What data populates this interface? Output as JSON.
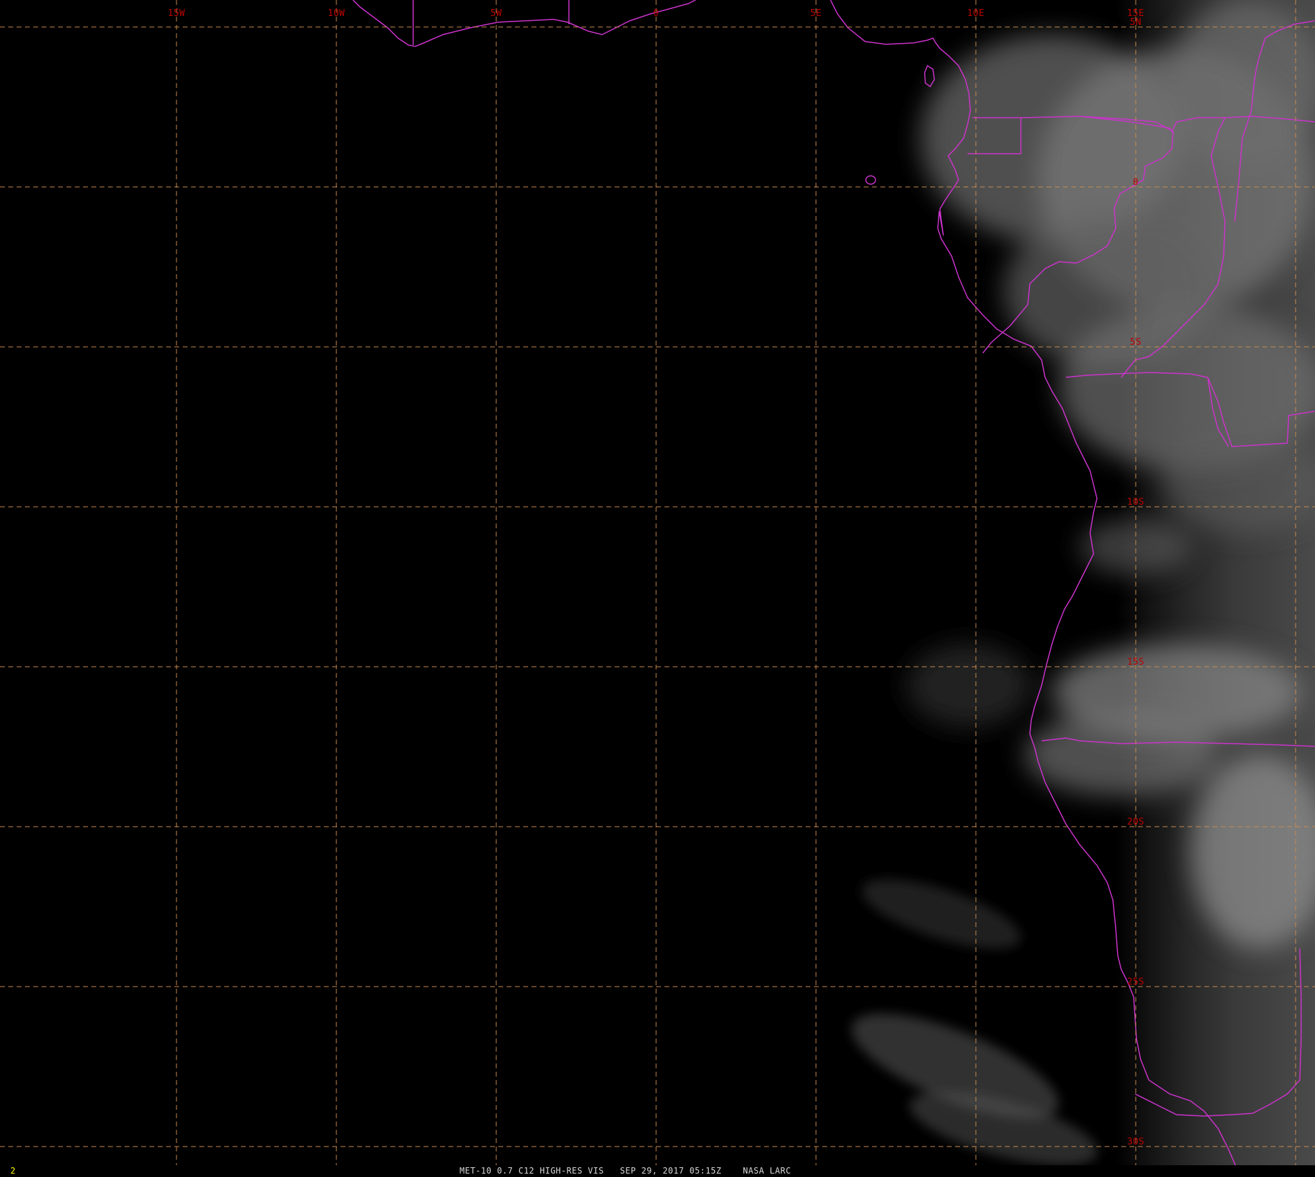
{
  "map": {
    "satellite": "MET-10",
    "channel": "0.7 C12",
    "product": "HIGH-RES VIS",
    "projection_bounds": {
      "lon_min": -20,
      "lon_max": 21.5,
      "lat_max": 5.5,
      "lat_min": -31
    },
    "longitude_lines": [
      {
        "lon": -15,
        "label": "15W"
      },
      {
        "lon": -10,
        "label": "10W"
      },
      {
        "lon": -5,
        "label": "5W"
      },
      {
        "lon": 0,
        "label": "0"
      },
      {
        "lon": 5,
        "label": "5E"
      },
      {
        "lon": 10,
        "label": "10E"
      },
      {
        "lon": 15,
        "label": "15E"
      },
      {
        "lon": 20,
        "label": ""
      }
    ],
    "latitude_lines": [
      {
        "lat": 5,
        "label": "5N"
      },
      {
        "lat": 0,
        "label": "0"
      },
      {
        "lat": -5,
        "label": "5S"
      },
      {
        "lat": -10,
        "label": "10S"
      },
      {
        "lat": -15,
        "label": "15S"
      },
      {
        "lat": -20,
        "label": "20S"
      },
      {
        "lat": -25,
        "label": "25S"
      },
      {
        "lat": -30,
        "label": "30S"
      }
    ],
    "colors": {
      "background": "#000000",
      "grid_lines": "#c88a50",
      "grid_labels": "#c00000",
      "boundaries": "#cc33cc",
      "frame_number": "#ffff00",
      "caption": "#d8d8d8"
    }
  },
  "status_bar": {
    "frame_number": "2",
    "caption": "MET-10 0.7 C12 HIGH-RES VIS   SEP 29, 2017 05:15Z    NASA LARC"
  }
}
